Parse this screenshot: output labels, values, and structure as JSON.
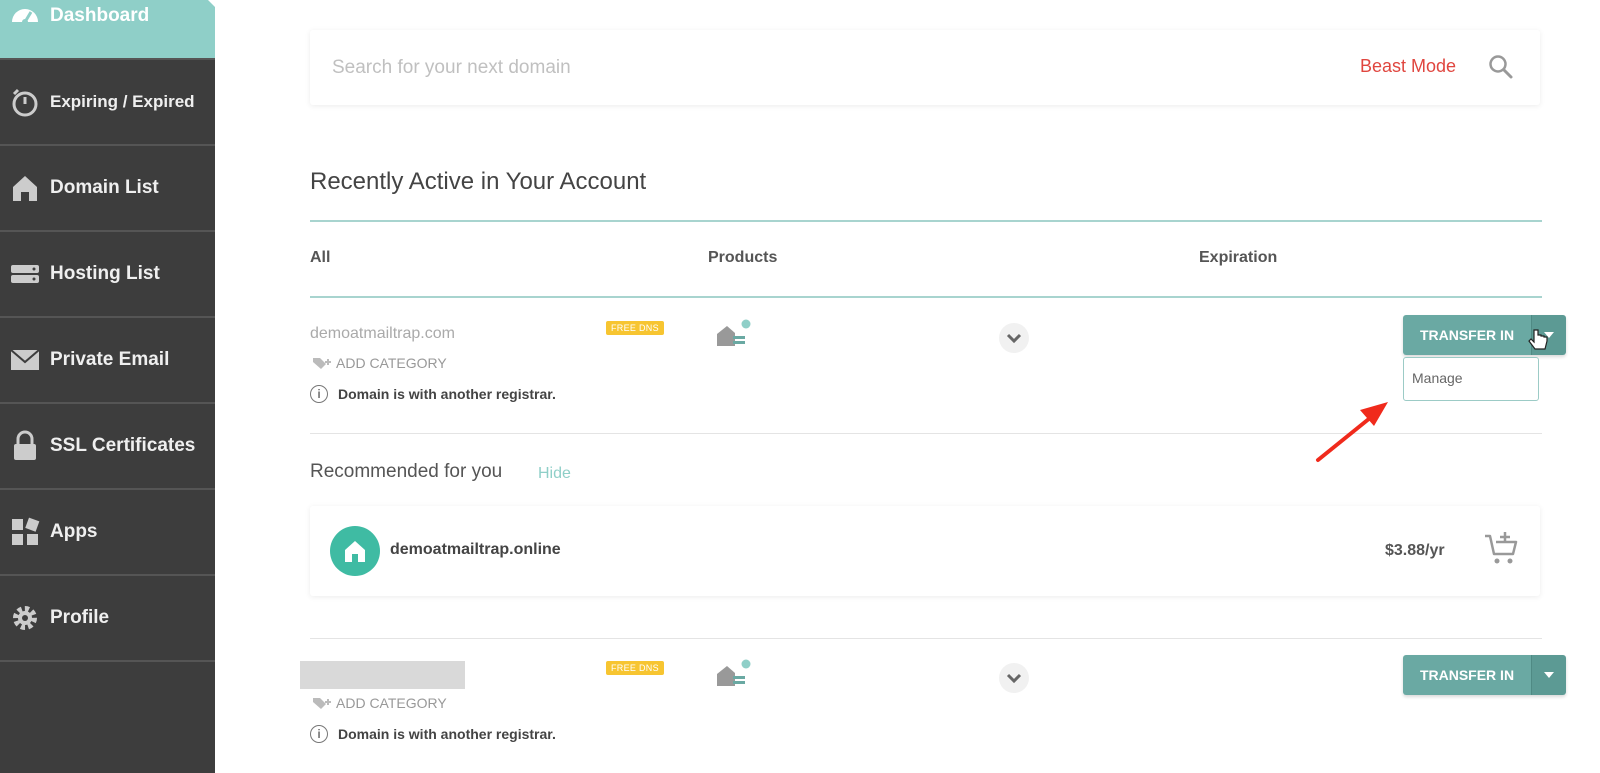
{
  "sidebar": {
    "items": [
      {
        "label": "Dashboard",
        "icon": "dashboard-gauge-icon",
        "active": true
      },
      {
        "label": "Expiring / Expired",
        "icon": "timer-icon"
      },
      {
        "label": "Domain List",
        "icon": "home-icon"
      },
      {
        "label": "Hosting List",
        "icon": "server-icon"
      },
      {
        "label": "Private Email",
        "icon": "envelope-icon"
      },
      {
        "label": "SSL Certificates",
        "icon": "lock-icon"
      },
      {
        "label": "Apps",
        "icon": "apps-grid-icon"
      },
      {
        "label": "Profile",
        "icon": "gear-icon"
      }
    ]
  },
  "search": {
    "placeholder": "Search for your next domain",
    "beast_mode": "Beast Mode"
  },
  "recent": {
    "title": "Recently Active in Your Account",
    "columns": {
      "all": "All",
      "products": "Products",
      "expiration": "Expiration"
    },
    "rows": [
      {
        "domain": "demoatmailtrap.com",
        "badge": "FREE DNS",
        "add_category": "ADD CATEGORY",
        "note": "Domain is with another registrar.",
        "action": "TRANSFER IN",
        "dropdown": [
          "Manage"
        ]
      },
      {
        "domain": "",
        "badge": "FREE DNS",
        "add_category": "ADD CATEGORY",
        "note": "Domain is with another registrar.",
        "action": "TRANSFER IN"
      }
    ]
  },
  "recommended": {
    "title": "Recommended for you",
    "hide": "Hide",
    "domain": "demoatmailtrap.online",
    "price": "$3.88/yr"
  },
  "colors": {
    "accent": "#8fcfc8",
    "button": "#6aa9a3",
    "beast_mode": "#e0463f",
    "badge": "#f7c531",
    "sidebar": "#3d3d3d"
  }
}
